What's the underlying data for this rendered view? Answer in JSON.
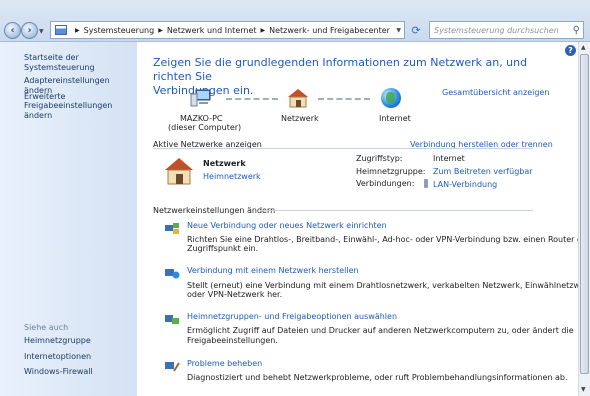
{
  "address_bar": {
    "crumbs": [
      "Systemsteuerung",
      "Netzwerk und Internet",
      "Netzwerk- und Freigabecenter"
    ],
    "search_placeholder": "Systemsteuerung durchsuchen"
  },
  "sidebar": {
    "items": [
      "Startseite der Systemsteuerung",
      "Adaptereinstellungen ändern",
      "Erweiterte",
      "Freigabeeinstellungen ändern"
    ],
    "see_also_label": "Siehe auch",
    "see_also": [
      "Heimnetzgruppe",
      "Internetoptionen",
      "Windows-Firewall"
    ]
  },
  "main": {
    "heading_line1": "Zeigen Sie die grundlegenden Informationen zum Netzwerk an, und richten Sie",
    "heading_line2": "Verbindungen ein.",
    "full_map_link": "Gesamtübersicht anzeigen",
    "map": {
      "computer_name": "MAZKO-PC",
      "computer_sub": "(dieser Computer)",
      "network": "Netzwerk",
      "internet": "Internet"
    },
    "active_networks_label": "Aktive Netzwerke anzeigen",
    "connect_link": "Verbindung herstellen oder trennen",
    "active_network": {
      "name": "Netzwerk",
      "type": "Heimnetzwerk",
      "access_type_label": "Zugriffstyp:",
      "access_type_value": "Internet",
      "homegroup_label": "Heimnetzgruppe:",
      "homegroup_value": "Zum Beitreten verfügbar",
      "connections_label": "Verbindungen:",
      "connections_value": "LAN-Verbindung"
    },
    "change_settings_label": "Netzwerkeinstellungen ändern",
    "tasks": [
      {
        "title": "Neue Verbindung oder neues Netzwerk einrichten",
        "line1": "Richten Sie eine Drahtlos-, Breitband-, Einwähl-, Ad-hoc- oder VPN-Verbindung bzw. einen Router oder",
        "line2": "Zugriffspunkt ein."
      },
      {
        "title": "Verbindung mit einem Netzwerk herstellen",
        "line1": "Stellt (erneut) eine Verbindung mit einem Drahtlosnetzwerk, verkabelten Netzwerk, Einwählnetzwerk",
        "line2": "oder VPN-Netzwerk her."
      },
      {
        "title": "Heimnetzgruppen- und Freigabeoptionen auswählen",
        "line1": "Ermöglicht Zugriff auf Dateien und Drucker auf anderen Netzwerkcomputern zu, oder ändert die",
        "line2": "Freigabeeinstellungen."
      },
      {
        "title": "Probleme beheben",
        "line1": "Diagnostiziert und behebt Netzwerkprobleme, oder ruft Problembehandlungsinformationen ab.",
        "line2": ""
      }
    ]
  }
}
